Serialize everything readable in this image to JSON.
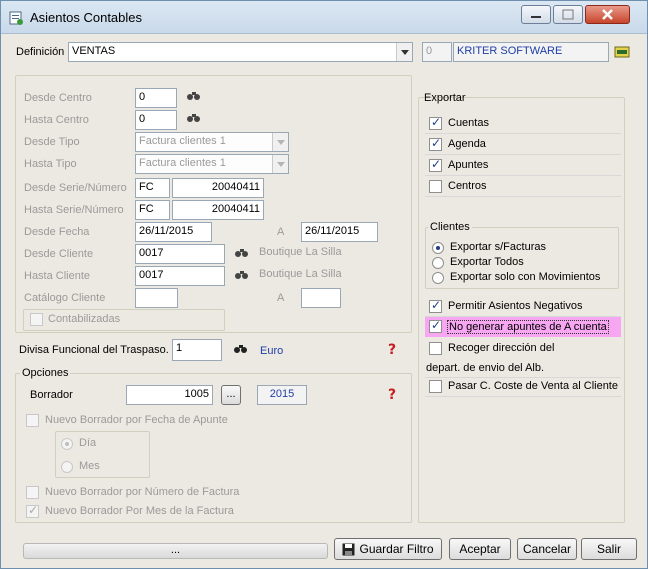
{
  "window": {
    "title": "Asientos Contables"
  },
  "definicion": {
    "label": "Definición",
    "value": "VENTAS",
    "code": "0",
    "company": "KRITER SOFTWARE"
  },
  "filters": {
    "desde_centro": {
      "label": "Desde Centro",
      "value": "0"
    },
    "hasta_centro": {
      "label": "Hasta Centro",
      "value": "0"
    },
    "desde_tipo": {
      "label": "Desde Tipo",
      "value": "Factura clientes 1"
    },
    "hasta_tipo": {
      "label": "Hasta Tipo",
      "value": "Factura clientes 1"
    },
    "desde_serie": {
      "label": "Desde Serie/Número",
      "serie": "FC",
      "numero": "20040411"
    },
    "hasta_serie": {
      "label": "Hasta Serie/Número",
      "serie": "FC",
      "numero": "20040411"
    },
    "desde_fecha": {
      "label": "Desde Fecha",
      "value": "26/11/2015",
      "a_label": "A",
      "a_value": "26/11/2015"
    },
    "desde_cliente": {
      "label": "Desde Cliente",
      "value": "0017",
      "name": "Boutique La Silla"
    },
    "hasta_cliente": {
      "label": "Hasta Cliente",
      "value": "0017",
      "name": "Boutique La Silla"
    },
    "catalogo": {
      "label": "Catálogo Cliente",
      "a_label": "A"
    },
    "contabilizadas": {
      "label": "Contabilizadas"
    }
  },
  "divisa": {
    "label": "Divisa Funcional del Traspaso.",
    "value": "1",
    "currency": "Euro"
  },
  "opciones": {
    "title": "Opciones",
    "borrador_label": "Borrador",
    "borrador_value": "1005",
    "browse_label": "...",
    "year": "2015",
    "nuevo_fecha": "Nuevo Borrador por Fecha de Apunte",
    "dia": "Día",
    "mes": "Mes",
    "nuevo_numero": "Nuevo Borrador por Número de Factura",
    "nuevo_mes": "Nuevo Borrador Por Mes de la Factura"
  },
  "exportar": {
    "title": "Exportar",
    "items": [
      {
        "label": "Cuentas",
        "checked": true
      },
      {
        "label": "Agenda",
        "checked": true
      },
      {
        "label": "Apuntes",
        "checked": true
      },
      {
        "label": "Centros",
        "checked": false
      }
    ]
  },
  "clientes": {
    "title": "Clientes",
    "options": [
      {
        "label": "Exportar s/Facturas",
        "selected": true
      },
      {
        "label": "Exportar Todos",
        "selected": false
      },
      {
        "label": "Exportar solo con Movimientos",
        "selected": false
      }
    ]
  },
  "extra": {
    "permitir": "Permitir Asientos Negativos",
    "no_generar": "No generar apuntes de A cuenta",
    "recoger_1": "Recoger dirección del",
    "recoger_2": "depart. de envio del Alb.",
    "pasar": "Pasar C. Coste de Venta al Cliente"
  },
  "footer": {
    "progress_label": "...",
    "guardar": "Guardar Filtro",
    "aceptar": "Aceptar",
    "cancelar": "Cancelar",
    "salir": "Salir"
  },
  "colors": {
    "highlight": "#f7a6f2",
    "accent_blue": "#1f3ea7"
  }
}
